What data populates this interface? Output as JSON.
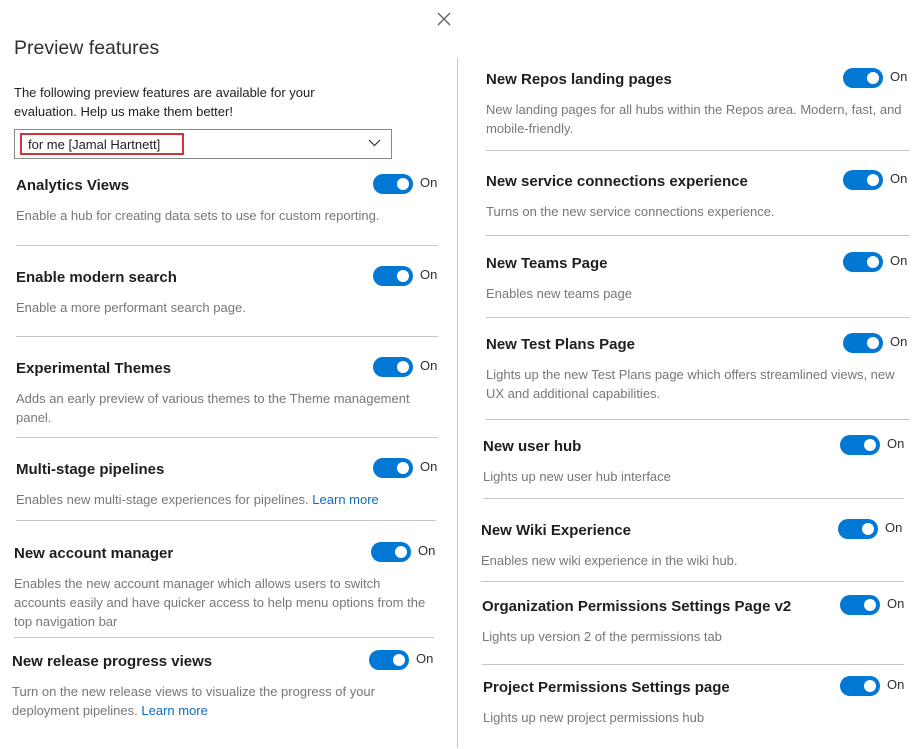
{
  "panel": {
    "title": "Preview features",
    "intro": "The following preview features are available for your evaluation. Help us make them better!",
    "scope_selected": "for me [Jamal Hartnett]"
  },
  "toggle_on_label": "On",
  "accent_color": "#0078d4",
  "highlight_color": "#d13438",
  "left_features": [
    {
      "name": "Analytics Views",
      "description": "Enable a hub for creating data sets to use for custom reporting.",
      "state": "On"
    },
    {
      "name": "Enable modern search",
      "description": "Enable a more performant search page.",
      "state": "On"
    },
    {
      "name": "Experimental Themes",
      "description": "Adds an early preview of various themes to the Theme management panel.",
      "state": "On"
    },
    {
      "name": "Multi-stage pipelines",
      "description": "Enables new multi-stage experiences for pipelines.",
      "link": "Learn more",
      "state": "On"
    },
    {
      "name": "New account manager",
      "description": "Enables the new account manager which allows users to switch accounts easily and have quicker access to help menu options from the top navigation bar",
      "state": "On"
    },
    {
      "name": "New release progress views",
      "description": "Turn on the new release views to visualize the progress of your deployment pipelines.",
      "link": "Learn more",
      "state": "On"
    }
  ],
  "right_features": [
    {
      "name": "New Repos landing pages",
      "description": "New landing pages for all hubs within the Repos area. Modern, fast, and mobile-friendly.",
      "state": "On"
    },
    {
      "name": "New service connections experience",
      "description": "Turns on the new service connections experience.",
      "state": "On"
    },
    {
      "name": "New Teams Page",
      "description": "Enables new teams page",
      "state": "On"
    },
    {
      "name": "New Test Plans Page",
      "description": "Lights up the new Test Plans page which offers streamlined views, new UX and additional capabilities.",
      "state": "On"
    },
    {
      "name": "New user hub",
      "description": "Lights up new user hub interface",
      "state": "On"
    },
    {
      "name": "New Wiki Experience",
      "description": "Enables new wiki experience in the wiki hub.",
      "state": "On"
    },
    {
      "name": "Organization Permissions Settings Page v2",
      "description": "Lights up version 2 of the permissions tab",
      "state": "On"
    },
    {
      "name": "Project Permissions Settings page",
      "description": "Lights up new project permissions hub",
      "state": "On"
    }
  ]
}
